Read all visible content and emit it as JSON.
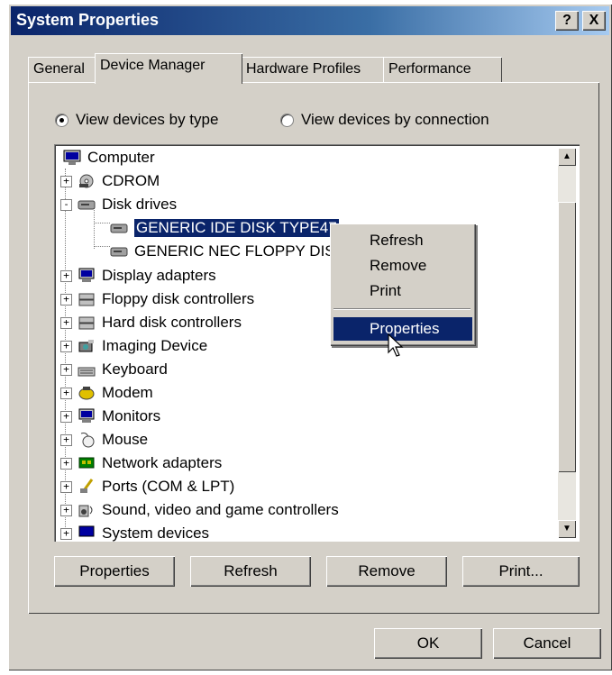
{
  "window": {
    "title": "System Properties",
    "help": "?",
    "close": "X"
  },
  "tabs": [
    {
      "label": "General"
    },
    {
      "label": "Device Manager"
    },
    {
      "label": "Hardware Profiles"
    },
    {
      "label": "Performance"
    }
  ],
  "view": {
    "by_type": "View devices by type",
    "by_connection": "View devices by connection",
    "selected": "by_type"
  },
  "tree": {
    "root": "Computer",
    "items": [
      {
        "label": "CDROM",
        "icon": "cdrom-icon",
        "expander": "+"
      },
      {
        "label": "Disk drives",
        "icon": "disk-drive-icon",
        "expander": "-"
      },
      {
        "label": "GENERIC IDE  DISK TYPE47",
        "icon": "disk-drive-icon",
        "child": true,
        "selected": true
      },
      {
        "label": "GENERIC NEC  FLOPPY DISK",
        "icon": "disk-drive-icon",
        "child": true
      },
      {
        "label": "Display adapters",
        "icon": "display-adapter-icon",
        "expander": "+"
      },
      {
        "label": "Floppy disk controllers",
        "icon": "floppy-controller-icon",
        "expander": "+"
      },
      {
        "label": "Hard disk controllers",
        "icon": "hdd-controller-icon",
        "expander": "+"
      },
      {
        "label": "Imaging Device",
        "icon": "imaging-device-icon",
        "expander": "+"
      },
      {
        "label": "Keyboard",
        "icon": "keyboard-icon",
        "expander": "+"
      },
      {
        "label": "Modem",
        "icon": "modem-icon",
        "expander": "+"
      },
      {
        "label": "Monitors",
        "icon": "monitor-icon",
        "expander": "+"
      },
      {
        "label": "Mouse",
        "icon": "mouse-icon",
        "expander": "+"
      },
      {
        "label": "Network adapters",
        "icon": "network-adapter-icon",
        "expander": "+"
      },
      {
        "label": "Ports (COM & LPT)",
        "icon": "ports-icon",
        "expander": "+"
      },
      {
        "label": "Sound, video and game controllers",
        "icon": "sound-icon",
        "expander": "+"
      },
      {
        "label": "System devices",
        "icon": "system-devices-icon",
        "expander": "+"
      }
    ]
  },
  "context_menu": {
    "refresh": "Refresh",
    "remove": "Remove",
    "print": "Print",
    "properties": "Properties"
  },
  "buttons": {
    "properties": "Properties",
    "refresh": "Refresh",
    "remove": "Remove",
    "print": "Print...",
    "ok": "OK",
    "cancel": "Cancel"
  },
  "colors": {
    "title_bar": "#0a246a",
    "selection": "#0a246a",
    "face": "#d4d0c8"
  }
}
